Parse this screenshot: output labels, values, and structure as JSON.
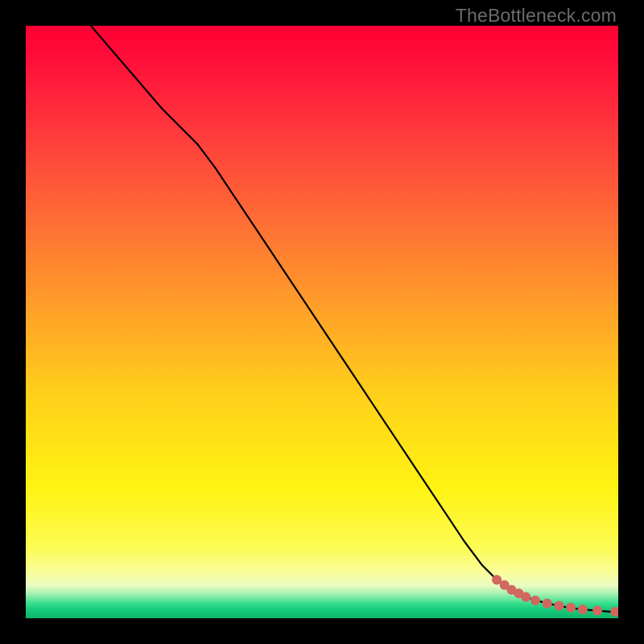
{
  "attribution": "TheBottleneck.com",
  "chart_data": {
    "type": "line",
    "title": "",
    "xlabel": "",
    "ylabel": "",
    "xlim": [
      0,
      100
    ],
    "ylim": [
      0,
      100
    ],
    "grid": false,
    "line_color": "#000000",
    "point_color": "#d1675f",
    "point_radius": 6,
    "series": [
      {
        "name": "curve",
        "x": [
          11,
          14,
          17,
          20,
          23,
          26,
          29,
          32,
          35,
          38,
          41,
          44,
          47,
          50,
          53,
          56,
          59,
          62,
          65,
          68,
          71,
          74,
          77,
          79.5,
          81.5,
          83.5,
          85.5,
          88,
          90.5,
          93,
          96,
          100
        ],
        "y": [
          100,
          96.5,
          93,
          89.5,
          86,
          83,
          80,
          76,
          71.5,
          67,
          62.5,
          58,
          53.5,
          49,
          44.5,
          40,
          35.5,
          31,
          26.5,
          22,
          17.5,
          13,
          9,
          6.5,
          5,
          4,
          3.2,
          2.5,
          2.0,
          1.6,
          1.3,
          1.0
        ]
      }
    ],
    "points": [
      {
        "x": 79.5,
        "y": 6.5
      },
      {
        "x": 80.8,
        "y": 5.6
      },
      {
        "x": 82.0,
        "y": 4.8
      },
      {
        "x": 83.2,
        "y": 4.2
      },
      {
        "x": 84.4,
        "y": 3.6
      },
      {
        "x": 86.0,
        "y": 3.0
      },
      {
        "x": 88.0,
        "y": 2.5
      },
      {
        "x": 90.0,
        "y": 2.1
      },
      {
        "x": 92.0,
        "y": 1.8
      },
      {
        "x": 94.0,
        "y": 1.5
      },
      {
        "x": 96.5,
        "y": 1.3
      },
      {
        "x": 99.5,
        "y": 1.1
      }
    ]
  }
}
